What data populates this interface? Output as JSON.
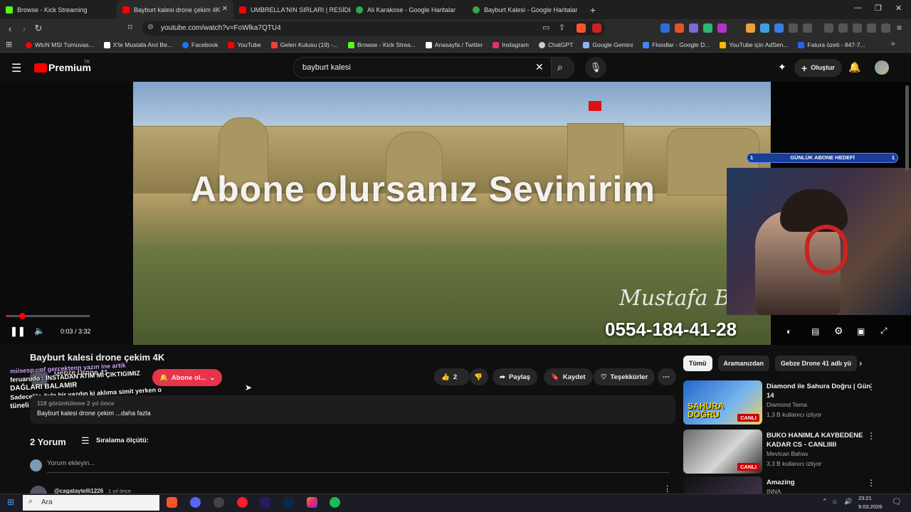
{
  "browser": {
    "tabs": [
      {
        "label": "Browse - Kick Streaming",
        "color": "#53fc18"
      },
      {
        "label": "Bayburt kalesi drone çekim 4K",
        "color": "#ff0000"
      },
      {
        "label": "UMBRELLA'NIN SIRLARI | RESİDENT",
        "color": "#ff0000"
      },
      {
        "label": "Ali Karakose - Google Haritalar",
        "color": "#34a853"
      },
      {
        "label": "Bayburt Kalesi - Google Haritalar",
        "color": "#34a853"
      }
    ],
    "url": "youtube.com/watch?v=FoWlka7QTU4",
    "bookmarks": [
      {
        "label": "WtcN MSI Turnuvas...",
        "color": "#ff0000"
      },
      {
        "label": "X'te Mustafa Anıl Be...",
        "color": "#ffffff"
      },
      {
        "label": "Facebook",
        "color": "#1877f2"
      },
      {
        "label": "YouTube",
        "color": "#ff0000"
      },
      {
        "label": "Gelen Kutusu (19) -...",
        "color": "#ea4335"
      },
      {
        "label": "Browse - Kick Strea...",
        "color": "#53fc18"
      },
      {
        "label": "Anasayfa / Twitter",
        "color": "#ffffff"
      },
      {
        "label": "Instagram",
        "color": "#e1306c"
      },
      {
        "label": "ChatGPT",
        "color": "#cccccc"
      },
      {
        "label": "Google Gemini",
        "color": "#8ab4f8"
      },
      {
        "label": "Floodlar - Google D...",
        "color": "#4285f4"
      },
      {
        "label": "YouTube için AdSen...",
        "color": "#fbbc04"
      },
      {
        "label": "Fatura özeti - 847-7...",
        "color": "#2266ee"
      }
    ]
  },
  "youtube": {
    "logo": "Premium",
    "logo_sup": "TR",
    "search_value": "bayburt kalesi",
    "create_label": "Oluştur",
    "player": {
      "overlay_text": "Abone olursanız Sevinirim",
      "signature": "Mustafa B",
      "phone": "0554-184-41-28",
      "goal_label": "GÜNLÜK ABONE HEDEFİ",
      "goal_left": "1",
      "goal_right": "1",
      "time": "0:03 / 3:32",
      "progress": 0.014
    },
    "video_title": "Bayburt kalesi drone çekim 4K",
    "channel_name": "Gebze Drone 41",
    "subscribe_label": "Abone ol...",
    "like_count": "2",
    "share_label": "Paylaş",
    "save_label": "Kaydet",
    "thanks_label": "Teşekkürler",
    "description": {
      "meta": "118 görüntüleme  2 yıl önce",
      "text": "Bayburt kalesi drone çekim ...daha fazla"
    },
    "chat": [
      "miisesp : of gercektenn yazın ine artik",
      "feruarudo : INSTADAN ATIM Mİ ÇIKTIGIMIZ",
      "DAĞLARI BALAMIR",
      "Sadecelilo öyle bir yazdın ki aklıma simit yerken o",
      "tüneli biz yaptık diyen binali geldi"
    ],
    "comments": {
      "count_label": "2 Yorum",
      "sort_label": "Sıralama ölçütü:",
      "add_placeholder": "Yorum ekleyin...",
      "first_author": "@cagataytelli1226",
      "first_time": "1 yıl önce"
    },
    "chips": [
      "Tümü",
      "Aramanızdan",
      "Gebze Drone 41 adlı yü"
    ],
    "recommendations": [
      {
        "title": "Diamond ile Sahura Doğru | Gün 14",
        "channel": "Diamond Tema",
        "views": "1,3 B kullanıcı izliyor",
        "live": "CANLI",
        "thumb_text": "SAHURA DOĞRU"
      },
      {
        "title": "BUKO HANIMLA KAYBEDENE KADAR CS - CANLIIIII",
        "channel": "Mevtcan Bahav",
        "views": "3,3 B kullanıcı izliyor",
        "live": "CANLI",
        "thumb_text": ""
      },
      {
        "title": "Amazing",
        "channel": "INNA",
        "views": "",
        "live": "",
        "thumb_text": ""
      }
    ]
  },
  "taskbar": {
    "search_label": "Ara",
    "time": "23:21",
    "date": "9.03.2026"
  }
}
